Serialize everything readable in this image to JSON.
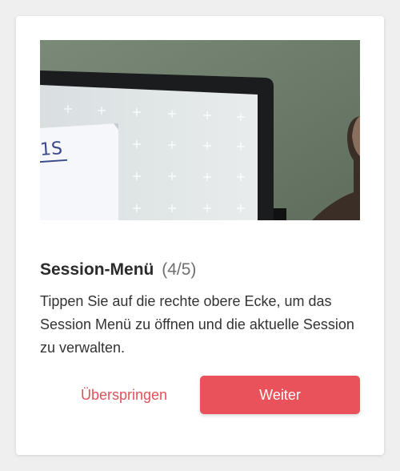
{
  "dialog": {
    "title": "Session-Menü",
    "step": "(4/5)",
    "description": "Tippen Sie auf die rechte obere Ecke, um das Session Menü zu öffnen und die aktuelle Session zu verwalten.",
    "skip_label": "Überspringen",
    "next_label": "Weiter"
  },
  "photo": {
    "paper_text": "1S"
  },
  "colors": {
    "accent": "#e9525a",
    "skip_text": "#e0525a",
    "background": "#efefef",
    "card": "#ffffff"
  }
}
